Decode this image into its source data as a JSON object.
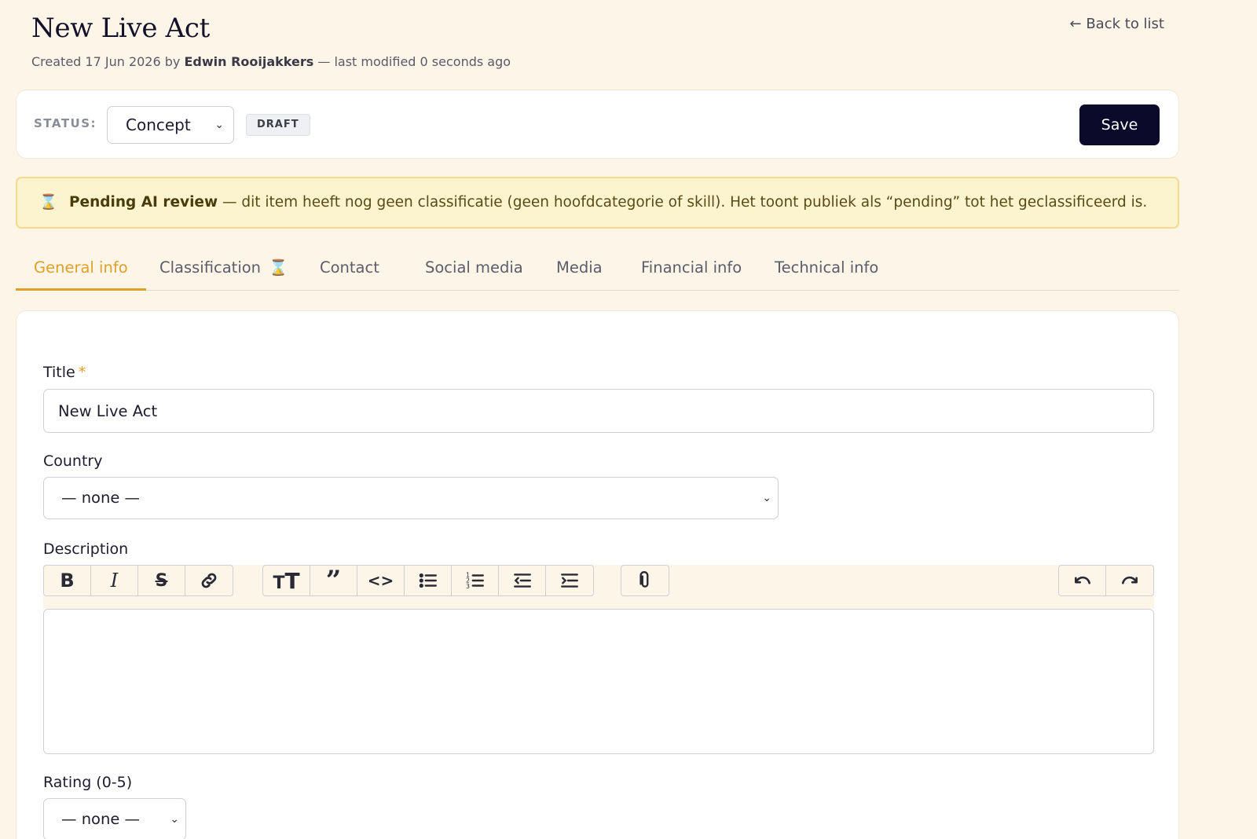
{
  "header": {
    "title": "New Live Act",
    "meta_created": "Created 17 Jun 2026 by",
    "meta_author": "Edwin Rooijakkers",
    "meta_modified": "— last modified 0 seconds ago",
    "back_link": "← Back to list"
  },
  "status": {
    "label": "STATUS:",
    "selected": "Concept",
    "badge": "DRAFT",
    "save_label": "Save"
  },
  "banner": {
    "icon": "hourglass-icon",
    "title": "Pending AI review",
    "text": " — dit item heeft nog geen classificatie (geen hoofdcategorie of skill). Het toont publiek als “pending” tot het geclassificeerd is."
  },
  "tabs": [
    {
      "label": "General info",
      "active": true
    },
    {
      "label": "Classification",
      "pending": true
    },
    {
      "label": "Contact"
    },
    {
      "label": "Social media"
    },
    {
      "label": "Media"
    },
    {
      "label": "Financial info"
    },
    {
      "label": "Technical info"
    }
  ],
  "form": {
    "title_label": "Title",
    "title_required": "*",
    "title_value": "New Live Act",
    "country_label": "Country",
    "country_value": "— none —",
    "description_label": "Description",
    "rating_label": "Rating (0-5)",
    "rating_value": "— none —"
  },
  "toolbar": {
    "groups": [
      [
        "bold-icon",
        "italic-icon",
        "strikethrough-icon",
        "link-icon"
      ],
      [
        "heading-icon",
        "quote-icon",
        "code-icon",
        "bullet-list-icon",
        "numbered-list-icon",
        "outdent-icon",
        "indent-icon"
      ],
      [
        "attachment-icon"
      ],
      [
        "undo-icon",
        "redo-icon"
      ]
    ]
  },
  "colors": {
    "background": "#fdf5e7",
    "accent": "#e0a02a",
    "save_button": "#0b0a2a",
    "banner_bg": "#fcf3cf"
  }
}
